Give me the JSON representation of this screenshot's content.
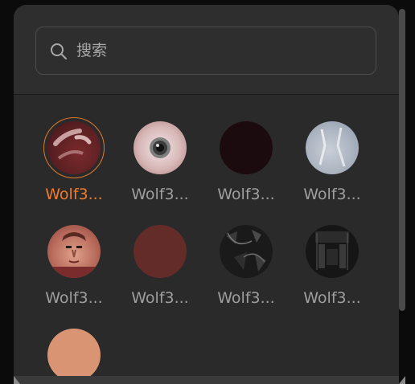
{
  "search": {
    "placeholder": "搜索"
  },
  "items": [
    {
      "label": "Wolf3...",
      "selected": true,
      "texture": "red-flesh-scar"
    },
    {
      "label": "Wolf3...",
      "selected": false,
      "texture": "eye"
    },
    {
      "label": "Wolf3...",
      "selected": false,
      "texture": "dark-maroon"
    },
    {
      "label": "Wolf3...",
      "selected": false,
      "texture": "pale-blue-white"
    },
    {
      "label": "Wolf3...",
      "selected": false,
      "texture": "face"
    },
    {
      "label": "Wolf3...",
      "selected": false,
      "texture": "rust-brown"
    },
    {
      "label": "Wolf3...",
      "selected": false,
      "texture": "black-grey-scraps"
    },
    {
      "label": "Wolf3...",
      "selected": false,
      "texture": "dark-mechanical"
    },
    {
      "label": "",
      "selected": false,
      "texture": "skin-tone"
    }
  ],
  "colors": {
    "accent": "#ef7c28",
    "panel": "#2a2a2a",
    "text": "#9e9e9e"
  }
}
